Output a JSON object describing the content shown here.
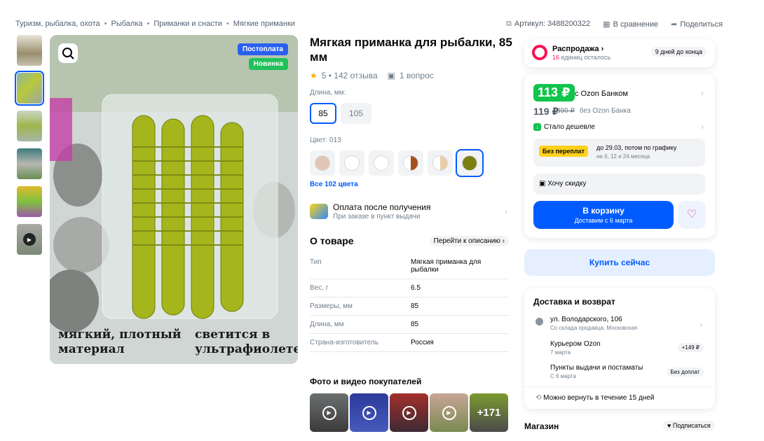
{
  "breadcrumbs": [
    "Туризм, рыбалка, охота",
    "Рыбалка",
    "Приманки и снасти",
    "Мягкие приманки"
  ],
  "meta": {
    "article": "Артикул: 3488200322",
    "compare": "В сравнение",
    "share": "Поделиться"
  },
  "gallery": {
    "badge_postpay": "Постоплата",
    "badge_new": "Новинка",
    "text_left": [
      "мягкий, плотный",
      "материал"
    ],
    "text_right": [
      "светится в",
      "ультрафиолете"
    ]
  },
  "product": {
    "title": "Мягкая приманка для рыбалки, 85 мм",
    "rating": "5 • 142 отзыва",
    "questions": "1 вопрос",
    "length_label": "Длина, мм:",
    "lengths": [
      "85",
      "105"
    ],
    "color_label": "Цвет: 013",
    "colors": [
      "#e2c6b4",
      "#ffffff",
      "#ffffff",
      "#a5521c",
      "#e9cda8",
      "#7b7f12"
    ],
    "all_colors": "Все 102 цвета",
    "pay_title": "Оплата после получения",
    "pay_sub": "При заказе в пункт выдачи"
  },
  "about": {
    "title": "О товаре",
    "go": "Перейти к описанию",
    "rows": [
      [
        "Тип",
        "Мягкая приманка для рыбалки"
      ],
      [
        "Вес, г",
        "6.5"
      ],
      [
        "Размеры, мм",
        "85"
      ],
      [
        "Длина, мм",
        "85"
      ],
      [
        "Страна-изготовитель",
        "Россия"
      ]
    ]
  },
  "photos": {
    "title": "Фото и видео покупателей",
    "more": "+171"
  },
  "sale": {
    "title": "Распродажа",
    "sub_count": "16",
    "sub": "единиц осталось",
    "days": "9 дней до конца"
  },
  "price": {
    "ozon": "113 ₽",
    "ozon_label": "с Ozon Банком",
    "regular": "119 ₽",
    "old": "390 ₽",
    "regular_label": "без Ozon Банка",
    "cheaper": "Стало дешевле",
    "installment_badge": "Без переплат",
    "installment_text": "до 29.03, потом по графику",
    "installment_sub": "на 6, 12 и 24 месяца",
    "want_discount": "Хочу скидку",
    "cart": "В корзину",
    "cart_sub": "Доставим с 6 марта",
    "buy_now": "Купить сейчас"
  },
  "delivery": {
    "title": "Доставка и возврат",
    "address": "ул. Володарского, 106",
    "address_sub": "Со склада продавца, Московская",
    "courier": "Курьером Ozon",
    "courier_date": "7 марта",
    "courier_price": "+149 ₽",
    "pickup": "Пункты выдачи и постаматы",
    "pickup_date": "С 6 марта",
    "pickup_price": "Без доплат",
    "return": "Можно вернуть в течение 15 дней"
  },
  "shop": {
    "title": "Магазин",
    "subscribe": "Подписаться"
  },
  "accent": "#005bff",
  "sale_pink": "#f91155"
}
